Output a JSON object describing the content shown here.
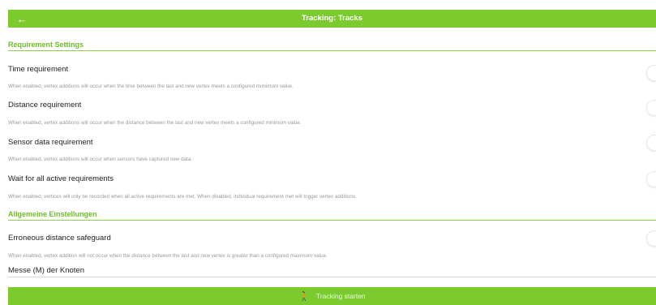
{
  "header": {
    "back_icon": "arrow-left-icon",
    "title": "Tracking: Tracks"
  },
  "sections": {
    "requirements": {
      "title": "Requirement Settings",
      "items": [
        {
          "label": "Time requirement",
          "desc": "When enabled, vertex additions will occur when the time between the last and new vertex meets a configured mimimum value.",
          "enabled": false
        },
        {
          "label": "Distance requirement",
          "desc": "When enabled, vertex additions will occur when the distance between the last and new vertex meets a configured minimum value.",
          "enabled": false
        },
        {
          "label": "Sensor data requirement",
          "desc": "When enabled, vertex additions will occur when sensors have captured new data.",
          "enabled": false
        },
        {
          "label": "Wait for all active requirements",
          "desc": "When enabled, vertices will only be recorded when all active requirements are met. When disabled, individual requirement met will trigger vertex additions.",
          "enabled": false
        }
      ]
    },
    "general": {
      "title": "Allgemeine Einstellungen",
      "items": [
        {
          "label": "Erroneous distance safeguard",
          "desc": "When enabled, vertex addition will not occur when the distance between the last and new vertex is greater than a configured maximum value.",
          "enabled": false
        }
      ],
      "field_label": "Messe (M) der Knoten"
    }
  },
  "footer": {
    "start_icon": "walking-person-icon",
    "start_label": "Tracking starten"
  },
  "colors": {
    "accent": "#7ccb2e",
    "section_title": "#6cbd24"
  }
}
